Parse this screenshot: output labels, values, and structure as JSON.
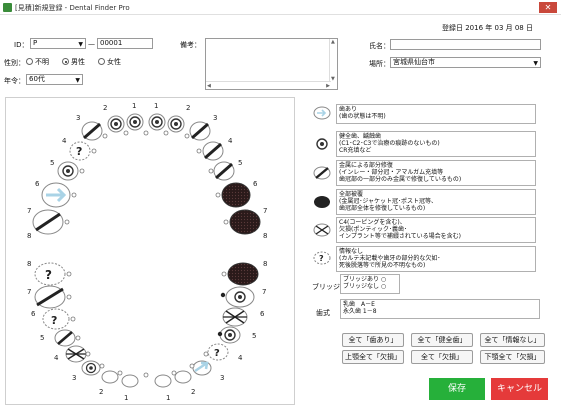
{
  "window": {
    "title": "[見積]新規登録 - Dental Finder Pro",
    "close_label": "✕"
  },
  "header": {
    "reg_date": "登録日 2016 年 03 月 08 日"
  },
  "patient": {
    "id_label": "ID：",
    "id_prefix": "P",
    "id_dash": "—",
    "id_number": "00001",
    "gender_label": "性別：",
    "gender_options": [
      "不明",
      "男性",
      "女性"
    ],
    "age_label": "年令：",
    "age_value": "60代",
    "notes_label": "備考：",
    "name_label": "氏名：",
    "name_value": "",
    "place_label": "場所：",
    "place_value": "宮城県仙台市"
  },
  "teeth_numbers": {
    "upper_right": [
      "1",
      "2",
      "3",
      "4",
      "5",
      "6",
      "7",
      "8"
    ],
    "upper_left": [
      "1",
      "2",
      "3",
      "4",
      "5",
      "6",
      "7",
      "8"
    ],
    "lower_right": [
      "1",
      "2",
      "3",
      "4",
      "5",
      "6",
      "7",
      "8"
    ],
    "lower_left": [
      "1",
      "2",
      "3",
      "4",
      "5",
      "6",
      "7",
      "8"
    ]
  },
  "legend": {
    "sound": [
      "歯あり",
      "(歯の状態は不明)"
    ],
    "caries": [
      "健全歯、齲蝕歯",
      "(C1･C2･C3で治療の痕跡のないもの)",
      "CR充填など"
    ],
    "partial": [
      "金属による部分修復",
      "(インレー・部分冠・アマルガム充填等",
      "歯冠部の一部分のみ金属で修復しているもの)"
    ],
    "full": [
      "全部被覆",
      "(金属冠･ジャケット冠･ポスト冠等、",
      "歯冠部全体を修復しているもの)"
    ],
    "missing": [
      "C4(コーピングを含む)、",
      "欠損(ポンティック･義歯･",
      "インプラント等で補綴されている場合を含む)"
    ],
    "unknown": [
      "情報なし",
      "(カルテ未記載や歯牙の部分的な欠如･",
      "死後脱落等で所見の不明なもの)"
    ],
    "bridge_label": "ブリッジ",
    "bridge": [
      "ブリッジあり ○",
      "ブリッジなし ○"
    ],
    "dentition_label": "歯式",
    "dentition": [
      "乳歯　A－E",
      "永久歯 1－8"
    ]
  },
  "buttons": {
    "all_present": "全て「歯あり」",
    "all_full": "全て「健全歯」",
    "all_unknown": "全て「情報なし」",
    "upper_missing": "上顎全て「欠損」",
    "all_missing": "全て「欠損」",
    "lower_missing": "下顎全て「欠損」",
    "save": "保存",
    "cancel": "キャンセル"
  },
  "colors": {
    "save": "#26b03a",
    "cancel": "#e53a3a",
    "full_crown": "#222222",
    "tooth_outline": "#888888",
    "tooth_sound": "#a9d3e6"
  }
}
